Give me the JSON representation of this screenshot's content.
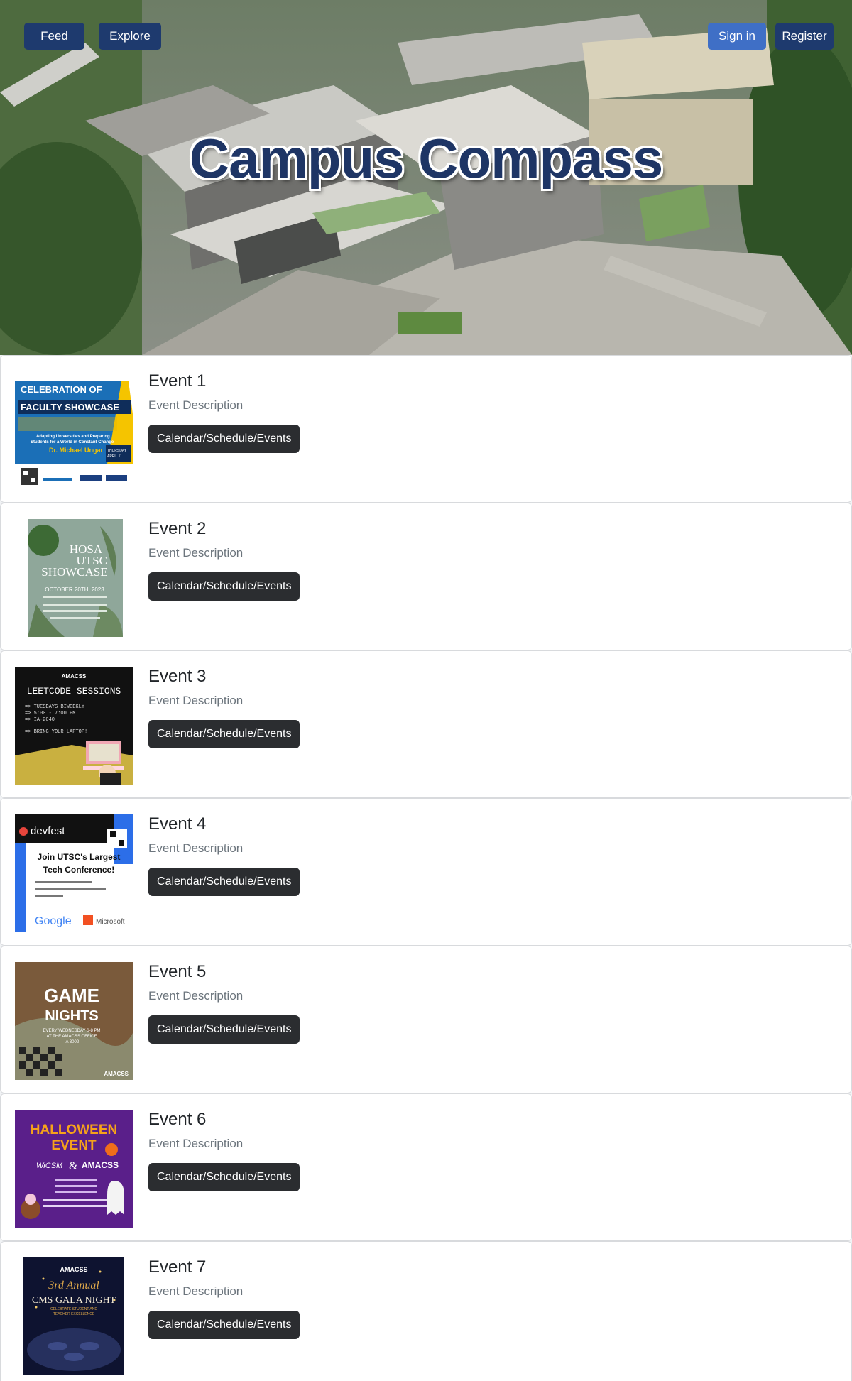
{
  "nav": {
    "feed_label": "Feed",
    "explore_label": "Explore",
    "signin_label": "Sign in",
    "register_label": "Register"
  },
  "hero": {
    "title": "Campus Compass"
  },
  "colors": {
    "nav_dark": "#1e3a6e",
    "nav_accent": "#3f6fc6",
    "title": "#1e3565",
    "event_button": "#2b2d30"
  },
  "events": [
    {
      "title": "Event 1",
      "description": "Event Description",
      "button_label": "Calendar/Schedule/Events",
      "poster": {
        "line1": "CELEBRATION OF",
        "line2": "FACULTY SHOWCASE",
        "line3": "Adapting Universities and Preparing",
        "line4": "Students for a World in Constant Change",
        "line5": "Dr. Michael Ungar",
        "line6": "THURSDAY",
        "line7": "APRIL 11"
      }
    },
    {
      "title": "Event 2",
      "description": "Event Description",
      "button_label": "Calendar/Schedule/Events",
      "poster": {
        "line1": "HOSA",
        "line2": "UTSC",
        "line3": "SHOWCASE",
        "line4": "OCTOBER 20TH, 2023"
      }
    },
    {
      "title": "Event 3",
      "description": "Event Description",
      "button_label": "Calendar/Schedule/Events",
      "poster": {
        "line1": "AMACSS",
        "line2": "LEETCODE SESSIONS",
        "line3": "=> TUESDAYS BIWEEKLY",
        "line4": "=> 5:00 - 7:00 PM",
        "line5": "=> IA-2040",
        "line6": "=> BRING YOUR LAPTOP!"
      }
    },
    {
      "title": "Event 4",
      "description": "Event Description",
      "button_label": "Calendar/Schedule/Events",
      "poster": {
        "line1": "devfest",
        "line2": "Join UTSC's Largest",
        "line3": "Tech Conference!",
        "line4": "Google",
        "line5": "Microsoft"
      }
    },
    {
      "title": "Event 5",
      "description": "Event Description",
      "button_label": "Calendar/Schedule/Events",
      "poster": {
        "line1": "GAME",
        "line2": "NIGHTS",
        "line3": "EVERY WEDNESDAY 6-8 PM",
        "line4": "AT THE AMACSS OFFICE",
        "line5": "IA 3002",
        "line6": "AMACSS"
      }
    },
    {
      "title": "Event 6",
      "description": "Event Description",
      "button_label": "Calendar/Schedule/Events",
      "poster": {
        "line1": "HALLOWEEN",
        "line2": "EVENT",
        "line3": "WiCSM",
        "line4": "&",
        "line5": "AMACSS"
      }
    },
    {
      "title": "Event 7",
      "description": "Event Description",
      "button_label": "Calendar/Schedule/Events",
      "poster": {
        "line1": "AMACSS",
        "line2": "3rd Annual",
        "line3": "CMS GALA NIGHT",
        "line4": "CELEBRATE STUDENT AND",
        "line5": "TEACHER EXCELLENCE"
      }
    }
  ]
}
